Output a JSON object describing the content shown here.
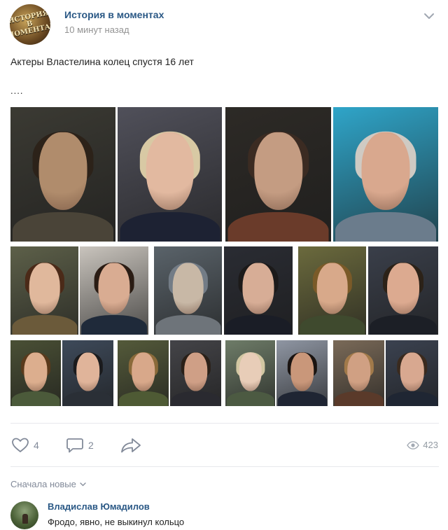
{
  "post": {
    "group_name": "История в моментах",
    "avatar_text_line1": "ИСТОРИЯ",
    "avatar_text_line2": "В МОМЕНТАХ",
    "time": "10 минут назад",
    "text": "Актеры Властелина колец спустя 16 лет",
    "ellipsis": "...."
  },
  "photos": [
    {
      "name": "aragorn-film",
      "bg": "#3b3a33",
      "face": "#b08c6c",
      "hair": "#2c2219",
      "body": "#4a4438"
    },
    {
      "name": "viggo-mortensen-now",
      "bg": "#50505a",
      "face": "#e2b9a0",
      "hair": "#d8c9a4",
      "body": "#1d2233"
    },
    {
      "name": "elrond-film",
      "bg": "#2d2a26",
      "face": "#c49c82",
      "hair": "#3b2b22",
      "body": "#6a3b2a"
    },
    {
      "name": "hugo-weaving-now",
      "bg": "#2fa5c9",
      "face": "#d9a88e",
      "hair": "#cfcac3",
      "body": "#6b7c8c"
    },
    {
      "name": "frodo-film",
      "bg": "#5d6049",
      "face": "#e0b89c",
      "hair": "#4b2a18",
      "body": "#6b5a3a"
    },
    {
      "name": "elijah-wood-now",
      "bg": "#c9c4bd",
      "face": "#d9ac92",
      "hair": "#2a1c14",
      "body": "#1f2a3a"
    },
    {
      "name": "gandalf-film",
      "bg": "#5a636a",
      "face": "#c8b8a6",
      "hair": "#737c86",
      "body": "#6e747a"
    },
    {
      "name": "ian-mckellen-now",
      "bg": "#2a2c33",
      "face": "#d7ad96",
      "hair": "#1c1a1a",
      "body": "#1a1d26"
    },
    {
      "name": "sam-film",
      "bg": "#6b6a3d",
      "face": "#d8a98a",
      "hair": "#7a5a28",
      "body": "#3f4a2e"
    },
    {
      "name": "sean-astin-now",
      "bg": "#3a3f4a",
      "face": "#dcaa90",
      "hair": "#2c2218",
      "body": "#1c1f26"
    },
    {
      "name": "pippin-film",
      "bg": "#4a5035",
      "face": "#dcae8e",
      "hair": "#5a3a1c",
      "body": "#4b5a3a"
    },
    {
      "name": "billy-boyd-now",
      "bg": "#3e4a5a",
      "face": "#e0b49a",
      "hair": "#1b1b1d",
      "body": "#2a2f36"
    },
    {
      "name": "merry-film",
      "bg": "#545a3a",
      "face": "#d8a88a",
      "hair": "#8a6a3a",
      "body": "#4e5a34"
    },
    {
      "name": "dominic-monaghan-now",
      "bg": "#444448",
      "face": "#cf9f86",
      "hair": "#2a2018",
      "body": "#2a2a30"
    },
    {
      "name": "legolas-film",
      "bg": "#6e7c68",
      "face": "#e8cdb8",
      "hair": "#d2c7a2",
      "body": "#4c5a42"
    },
    {
      "name": "orlando-bloom-now",
      "bg": "#8f96a3",
      "face": "#c9977a",
      "hair": "#1a1411",
      "body": "#1f2533"
    },
    {
      "name": "boromir-film",
      "bg": "#7a6a58",
      "face": "#d0a083",
      "hair": "#a27a4a",
      "body": "#5a3a2a"
    },
    {
      "name": "sean-bean-now",
      "bg": "#3b4250",
      "face": "#d8a890",
      "hair": "#3a2a1e",
      "body": "#1f2633"
    }
  ],
  "actions": {
    "likes": "4",
    "comments": "2",
    "views": "423"
  },
  "comments_section": {
    "sort_label": "Сначала новые",
    "comment": {
      "author": "Владислав Юмадилов",
      "text": "Фродо, явно, не выкинул кольцо"
    }
  },
  "colors": {
    "link": "#2a5885",
    "muted": "#828a99",
    "divider": "#e7e8ec"
  }
}
